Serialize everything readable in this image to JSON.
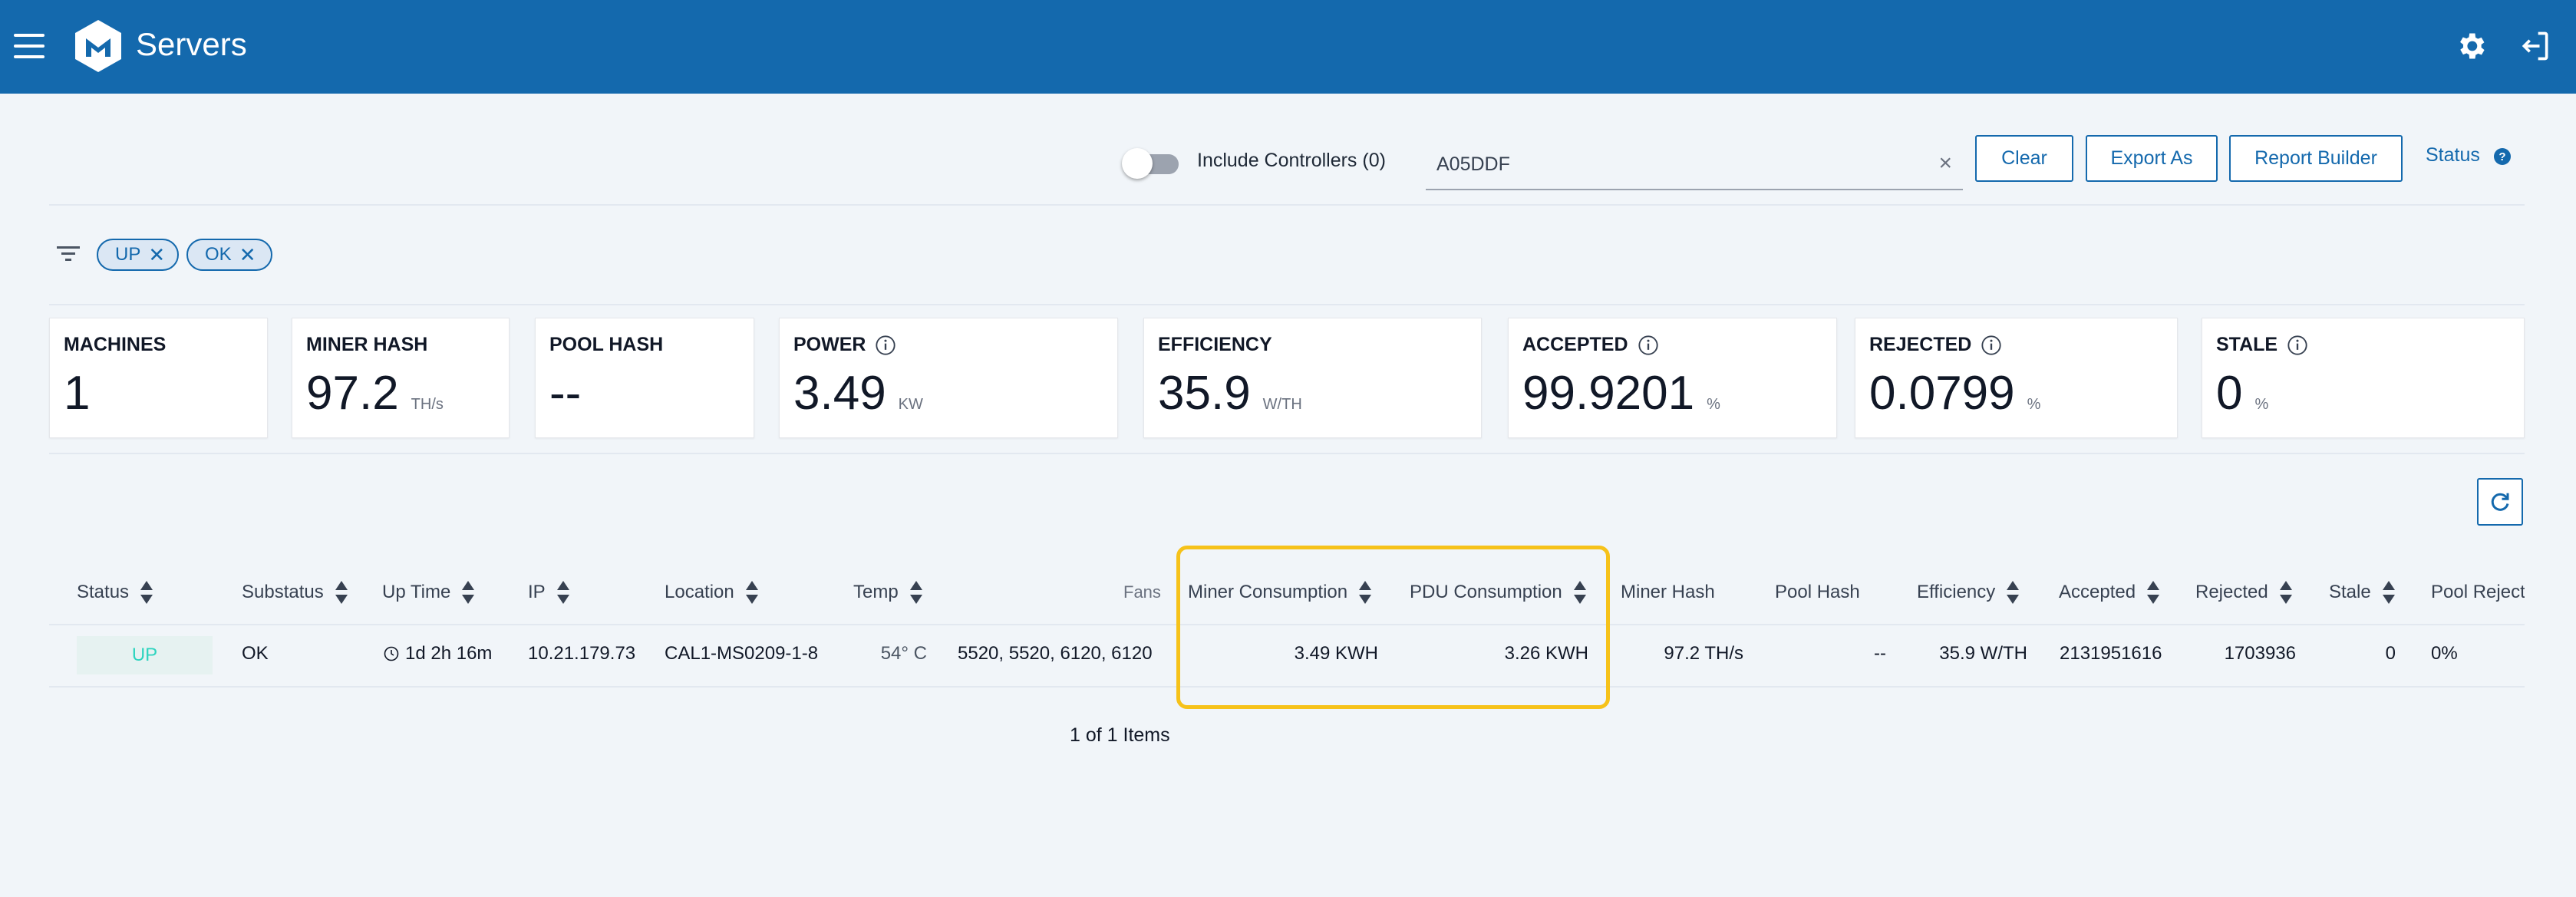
{
  "header": {
    "title": "Servers"
  },
  "controls": {
    "include_controllers_label": "Include Controllers (0)",
    "search_value": "A05DDF",
    "clear_x": "×",
    "clear_label": "Clear",
    "export_label": "Export As",
    "report_label": "Report Builder",
    "status_label": "Status"
  },
  "filters": {
    "chips": [
      "UP",
      "OK"
    ]
  },
  "stats": [
    {
      "label": "MACHINES",
      "value": "1",
      "unit": ""
    },
    {
      "label": "MINER HASH",
      "value": "97.2",
      "unit": "TH/s"
    },
    {
      "label": "POOL HASH",
      "value": "--",
      "unit": ""
    },
    {
      "label": "POWER",
      "value": "3.49",
      "unit": "KW"
    },
    {
      "label": "EFFICIENCY",
      "value": "35.9",
      "unit": "W/TH"
    },
    {
      "label": "ACCEPTED",
      "value": "99.9201",
      "unit": "%"
    },
    {
      "label": "REJECTED",
      "value": "0.0799",
      "unit": "%"
    },
    {
      "label": "STALE",
      "value": "0",
      "unit": "%"
    }
  ],
  "table": {
    "columns": [
      "Status",
      "Substatus",
      "Up Time",
      "IP",
      "Location",
      "Temp",
      "Fans",
      "Miner Consumption",
      "PDU Consumption",
      "Miner Hash",
      "Pool Hash",
      "Efficiency",
      "Accepted",
      "Rejected",
      "Stale",
      "Pool Reject"
    ],
    "rows": [
      {
        "status": "UP",
        "substatus": "OK",
        "uptime": "1d 2h 16m",
        "ip": "10.21.179.73",
        "location": "CAL1-MS0209-1-8",
        "temp": "54° C",
        "fans": "5520, 5520, 6120, 6120",
        "miner_consumption": "3.49 KWH",
        "pdu_consumption": "3.26 KWH",
        "miner_hash": "97.2 TH/s",
        "pool_hash": "--",
        "efficiency": "35.9 W/TH",
        "accepted": "2131951616",
        "rejected": "1703936",
        "stale": "0",
        "pool_reject": "0%"
      }
    ]
  },
  "pager": "1 of 1 Items",
  "colors": {
    "primary": "#1469ad",
    "highlight": "#f6c21a",
    "status_up": "#2dd4bf"
  }
}
